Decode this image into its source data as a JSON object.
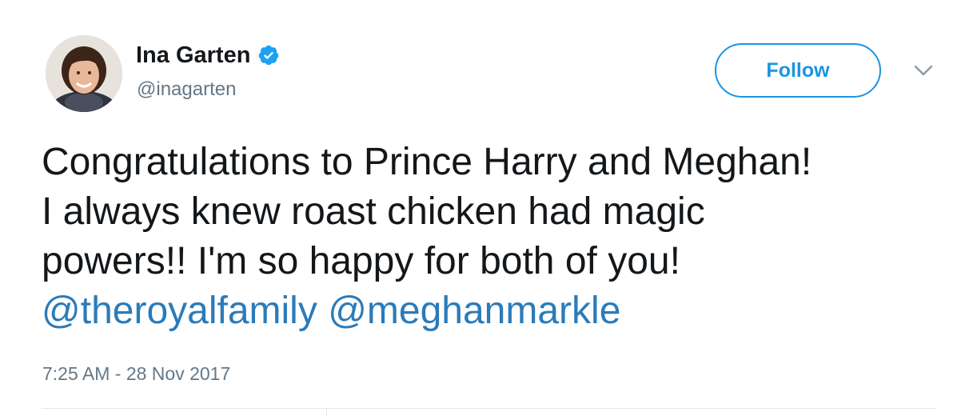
{
  "author": {
    "display_name": "Ina Garten",
    "handle": "@inagarten",
    "verified_icon": "verified-badge-icon",
    "avatar_icon": "profile-photo"
  },
  "actions": {
    "follow_label": "Follow",
    "menu_icon": "chevron-down-icon"
  },
  "tweet": {
    "text_line1": "Congratulations to Prince Harry and Meghan!",
    "text_line2": "I always knew roast chicken had magic",
    "text_line3": "powers!! I'm so happy for both of you!",
    "mentions": [
      "@theroyalfamily",
      "@meghanmarkle"
    ],
    "timestamp": "7:25 AM - 28 Nov 2017"
  },
  "colors": {
    "accent": "#1b95e0",
    "mention": "#2b7bb9",
    "text": "#14171a",
    "secondary": "#657786"
  }
}
